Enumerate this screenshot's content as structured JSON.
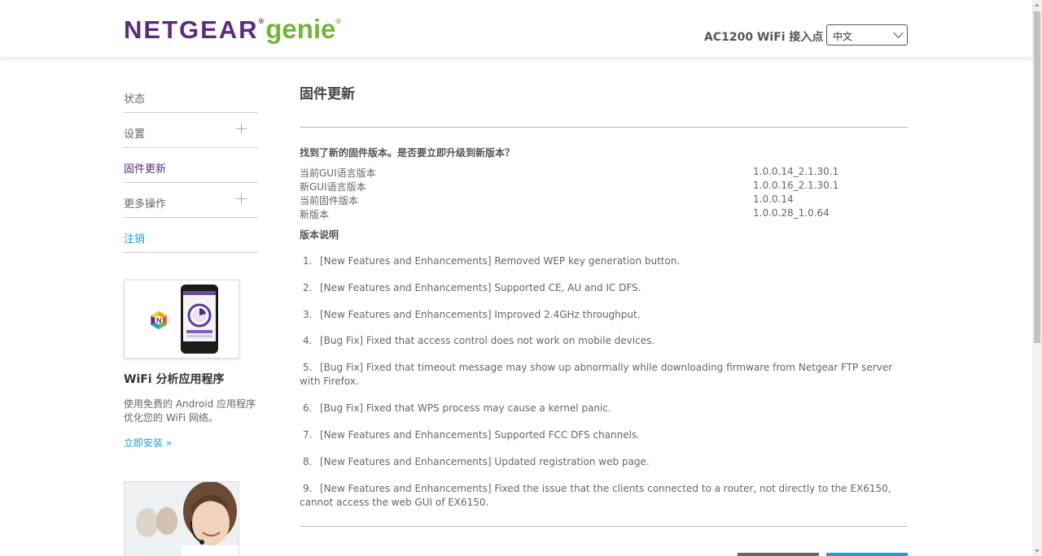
{
  "header": {
    "logo_brand": "NETGEAR",
    "logo_reg": "®",
    "logo_genie": "genie",
    "logo_reg2": "®",
    "device_name": "AC1200 WiFi 接入点",
    "language": "中文"
  },
  "sidebar": {
    "items": [
      {
        "label": "状态"
      },
      {
        "label": "设置"
      },
      {
        "label": "固件更新"
      },
      {
        "label": "更多操作"
      },
      {
        "label": "注销"
      }
    ]
  },
  "promo": {
    "title": "WiFi 分析应用程序",
    "text": "使用免费的 Android 应用程序优化您的 WiFi 网络。",
    "link": "立即安装 »"
  },
  "main": {
    "title": "固件更新",
    "question": "找到了新的固件版本。是否要立即升级到新版本？",
    "versions": [
      {
        "label": "当前GUI语言版本",
        "value": "1.0.0.14_2.1.30.1"
      },
      {
        "label": "新GUI语言版本",
        "value": "1.0.0.16_2.1.30.1"
      },
      {
        "label": "当前固件版本",
        "value": "1.0.0.14"
      },
      {
        "label": "新版本",
        "value": "1.0.0.28_1.0.64"
      }
    ],
    "notes_title": "版本说明",
    "notes": [
      {
        "num": "1.",
        "text": "[New Features and Enhancements] Removed WEP key generation button."
      },
      {
        "num": "2.",
        "text": "[New Features and Enhancements] Supported CE, AU and IC DFS."
      },
      {
        "num": "3.",
        "text": "[New Features and Enhancements] Improved 2.4GHz throughput."
      },
      {
        "num": "4.",
        "text": "[Bug Fix] Fixed that access control does not work on mobile devices."
      },
      {
        "num": "5.",
        "text": "[Bug Fix] Fixed that timeout message may show up abnormally while downloading firmware from Netgear FTP server with Firefox."
      },
      {
        "num": "6.",
        "text": "[Bug Fix] Fixed that WPS process may cause a kernel panic."
      },
      {
        "num": "7.",
        "text": "[New Features and Enhancements] Supported FCC DFS channels."
      },
      {
        "num": "8.",
        "text": "[New Features and Enhancements] Updated registration web page."
      },
      {
        "num": "9.",
        "text": "[New Features and Enhancements] Fixed the issue that the clients connected to a router, not directly to the EX6150, cannot access the web GUI of EX6150."
      }
    ]
  },
  "colors": {
    "brand_purple": "#5d2a82",
    "genie_green": "#6fb738",
    "link_blue": "#1aa0d8"
  }
}
